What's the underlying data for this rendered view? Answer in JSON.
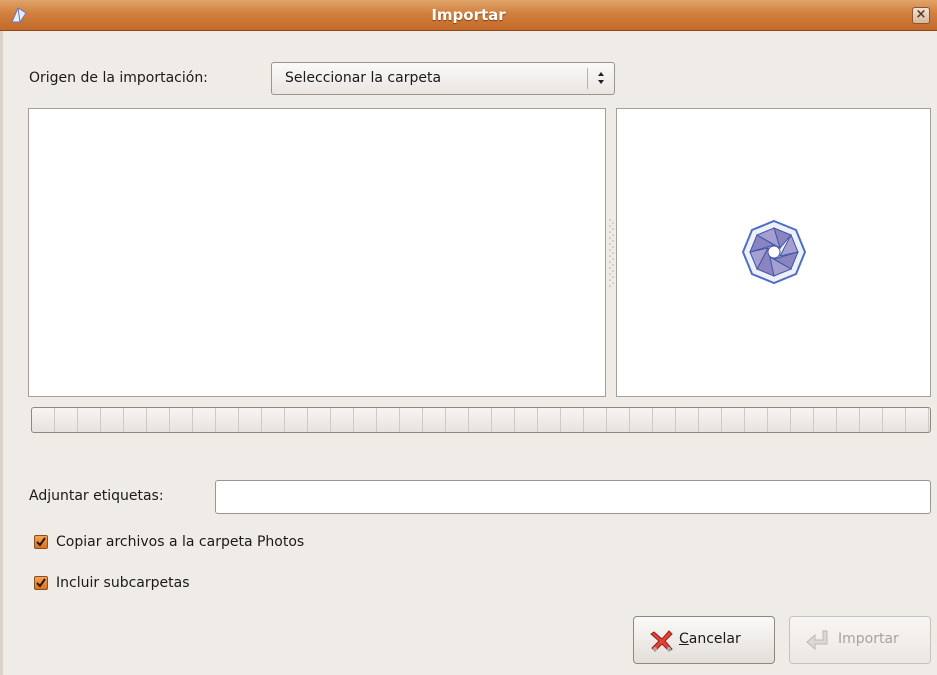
{
  "window": {
    "title": "Importar",
    "close_label": "×"
  },
  "origin": {
    "label": "Origen de la importación:",
    "selected": "Seleccionar la carpeta"
  },
  "tags": {
    "label": "Adjuntar etiquetas:",
    "value": ""
  },
  "options": [
    {
      "label": "Copiar archivos a la carpeta Photos",
      "checked": true
    },
    {
      "label": "Incluir subcarpetas",
      "checked": true
    }
  ],
  "buttons": {
    "cancel": {
      "mnemonic": "C",
      "rest": "ancelar",
      "icon": "cancel-x-icon"
    },
    "import": {
      "label": "Importar",
      "icon": "import-arrow-icon",
      "enabled": false
    }
  },
  "progress": {
    "value": 0
  },
  "colors": {
    "titlebar": "#d27f3c",
    "checkbox": "#e08a3a",
    "accent": "#5b63b8"
  }
}
